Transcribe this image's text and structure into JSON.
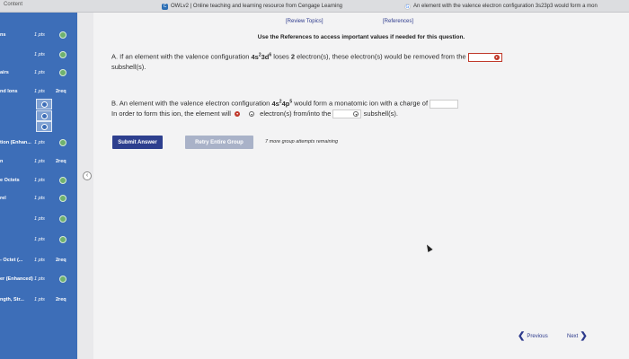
{
  "browser": {
    "tab_left": "Content",
    "tab_owl": "OWLv2 | Online teaching and learning resource from Cengage Learning",
    "tab_google": "An element with the valence electron configuration 3s23p3 would form a mon"
  },
  "sidebar": {
    "rows": [
      {
        "label": "ns",
        "pts": "1 pts",
        "req": "",
        "check": true
      },
      {
        "label": "",
        "pts": "1 pts",
        "req": "",
        "check": true
      },
      {
        "label": "airs",
        "pts": "1 pts",
        "req": "",
        "check": true
      },
      {
        "label": "nd Ions",
        "pts": "1 pts",
        "req": "2req",
        "check": false
      },
      {
        "label": "tion (Enhan...",
        "pts": "1 pts",
        "req": "",
        "check": true
      },
      {
        "label": "n",
        "pts": "1 pts",
        "req": "2req",
        "check": false
      },
      {
        "label": "e Octets",
        "pts": "1 pts",
        "req": "",
        "check": true
      },
      {
        "label": "rel",
        "pts": "1 pts",
        "req": "",
        "check": true
      },
      {
        "label": "",
        "pts": "1 pts",
        "req": "",
        "check": true
      },
      {
        "label": "",
        "pts": "1 pts",
        "req": "",
        "check": true
      },
      {
        "label": "- Octet (...",
        "pts": "1 pts",
        "req": "2req",
        "check": false
      },
      {
        "label": "er (Enhanced)",
        "pts": "1 pts",
        "req": "",
        "check": true
      },
      {
        "label": "ngth, Str...",
        "pts": "1 pts",
        "req": "2req",
        "check": false
      }
    ],
    "collapse_icon": "‹"
  },
  "main": {
    "review_topics": "[Review Topics]",
    "references": "[References]",
    "instruction": "Use the References to access important values if needed for this question.",
    "qA": {
      "prefix": "A. If an element with the valence configuration ",
      "config_base1": "4s",
      "config_sup1": "2",
      "config_base2": "3d",
      "config_sup2": "6",
      "middle": " loses ",
      "count": "2",
      "suffix": " electron(s), these electron(s) would be removed from the",
      "tail": "subshell(s)."
    },
    "qB": {
      "line1_prefix": "B. An element with the valence electron configuration ",
      "config_base1": "4s",
      "config_sup1": "2",
      "config_base2": "4p",
      "config_sup2": "5",
      "line1_suffix": " would form a monatomic ion with a charge of",
      "line2_a": "In order to form this ion, the element will",
      "line2_b": "electron(s) from/into the",
      "line2_c": "subshell(s)."
    },
    "submit_label": "Submit Answer",
    "retry_label": "Retry Entire Group",
    "attempts_text": "7 more group attempts remaining",
    "previous_label": "Previous",
    "next_label": "Next"
  }
}
